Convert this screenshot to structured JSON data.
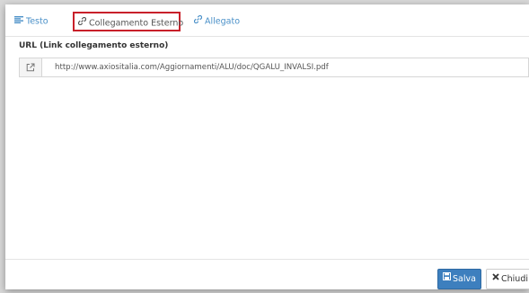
{
  "tabs": [
    {
      "label": "Testo",
      "icon": "align-left-icon",
      "active": false
    },
    {
      "label": "Collegamento Esterno",
      "icon": "link-icon",
      "active": true
    },
    {
      "label": "Allegato",
      "icon": "paperclip-icon",
      "active": false
    }
  ],
  "form": {
    "url_label": "URL (Link collegamento esterno)",
    "url_value": "http://www.axiositalia.com/Aggiornamenti/ALU/doc/QGALU_INVALSI.pdf",
    "url_icon": "external-link-icon"
  },
  "footer": {
    "save_label": "Salva",
    "save_icon": "floppy-disk-icon",
    "close_label": "Chiudi",
    "close_icon": "close-icon"
  },
  "colors": {
    "link": "#4a90c8",
    "highlight_border": "#c8202a",
    "primary_button": "#3d7fbe"
  }
}
